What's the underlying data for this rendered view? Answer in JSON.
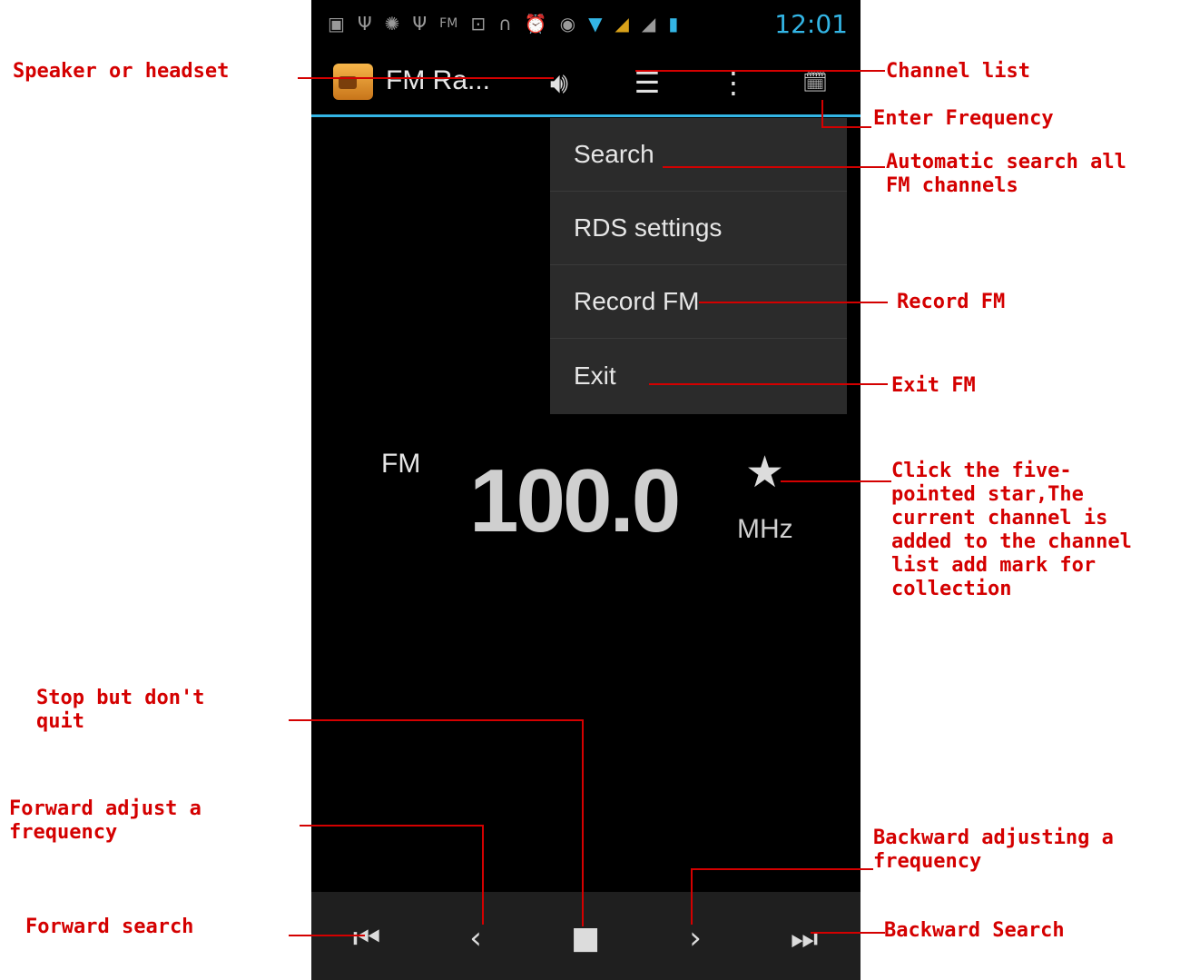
{
  "status_bar": {
    "icons": [
      "notification-icon",
      "usb-icon",
      "android-debug-icon",
      "usb-icon",
      "fm-icon",
      "sim-icon",
      "headset-icon",
      "alarm-icon",
      "sync-icon",
      "wifi-icon",
      "signal-icon",
      "signal-icon",
      "battery-icon"
    ],
    "fm_text": "FM",
    "time": "12:01"
  },
  "action_bar": {
    "title": "FM Ra...",
    "speaker_icon": "speaker-icon",
    "channel_list_icon": "list-icon",
    "overflow_icon": "overflow-menu-icon",
    "frequency_icon": "calendar-list-icon"
  },
  "menu": {
    "items": [
      "Search",
      "RDS settings",
      "Record FM",
      "Exit"
    ]
  },
  "tuner": {
    "band": "FM",
    "frequency": "100.0",
    "unit": "MHz",
    "favorite_icon": "star-icon"
  },
  "controls": {
    "icons": [
      "skip-previous-icon",
      "chevron-left-icon",
      "stop-icon",
      "chevron-right-icon",
      "skip-next-icon"
    ]
  },
  "annotations": {
    "speaker": "Speaker or headset",
    "channel_list": "Channel list",
    "enter_frequency": "Enter Frequency",
    "search": "Automatic search all\nFM channels",
    "record": "Record FM",
    "exit": "Exit FM",
    "star": "Click the five-\npointed star,The\ncurrent channel is\nadded to the channel\nlist add mark for\ncollection",
    "stop": "Stop but don't\nquit",
    "forward_adjust": "Forward adjust a\nfrequency",
    "backward_adjust": "Backward adjusting a\nfrequency",
    "forward_search": "Forward search",
    "backward_search": "Backward Search"
  },
  "colors": {
    "annotation": "#d40000",
    "accent": "#33b5e5"
  }
}
